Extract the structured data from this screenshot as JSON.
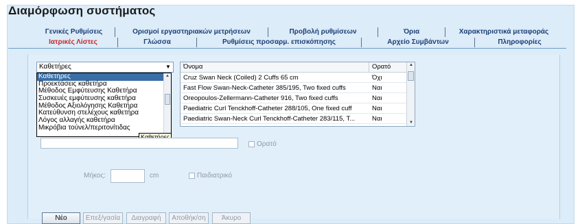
{
  "page": {
    "title": "Διαμόρφωση συστήματος"
  },
  "tabs": {
    "row1": [
      {
        "label": "Γενικές Ρυθμίσεις"
      },
      {
        "label": "Ορισμοί εργαστηριακών μετρήσεων"
      },
      {
        "label": "Προβολή ρυθμίσεων"
      },
      {
        "label": "Όρια"
      },
      {
        "label": "Χαρακτηριστικά μεταφοράς"
      }
    ],
    "row2": [
      {
        "label": "Ιατρικές Λίστες",
        "active": true
      },
      {
        "label": "Γλώσσα"
      },
      {
        "label": "Ρυθμίσεις προσαρμ. επισκόπησης"
      },
      {
        "label": "Αρχείο Συμβάντων"
      },
      {
        "label": "Πληροφορίες"
      }
    ]
  },
  "list_selector": {
    "value": "Καθετήρες",
    "options": [
      "Καθετήρες",
      "Προεκτάσεις καθετήρα",
      "Μέθοδος Εμφύτευσης Καθετήρα",
      "Συσκευές εμφύτευσης καθετήρα",
      "Μέθοδος Αξιολόγησης Καθετήρα",
      "Κατεύθυνση στελέχους καθετήρα",
      "Λόγος αλλαγής καθετήρα",
      "Μικρόβια τούνελ/περιτονίτιδας"
    ],
    "selected_index": 0,
    "tooltip": "Καθετήρες"
  },
  "grid": {
    "columns": [
      "Όνομα",
      "Ορατό"
    ],
    "rows": [
      [
        "Cruz Swan Neck (Coiled) 2 Cuffs 65 cm",
        "Όχι"
      ],
      [
        "Fast Flow Swan-Neck-Catheter 385/195, Two fixed cuffs",
        "Ναι"
      ],
      [
        "Oreopoulos-Zellermann-Catheter 916, Two fixed cuffs",
        "Ναι"
      ],
      [
        "Paediatric Curl Tenckhoff-Catheter 288/105, One fixed cuff",
        "Ναι"
      ],
      [
        "Paediatric Swan-Neck Curl Tenckhoff-Catheter 283/115, T...",
        "Ναι"
      ]
    ]
  },
  "form": {
    "visible_label": "Ορατό",
    "length_label": "Μήκος:",
    "length_unit": "cm",
    "pediatric_label": "Παιδιατρικό"
  },
  "buttons": {
    "new": "Νέο",
    "edit": "Επεξ/γασία",
    "delete": "Διαγραφή",
    "save": "Αποθήκ/ση",
    "cancel": "Άκυρο"
  },
  "colors": {
    "background": "#dcecf8",
    "active_tab": "#c8282d",
    "tab_text": "#1c3f78",
    "selection": "#3a6ea5"
  }
}
